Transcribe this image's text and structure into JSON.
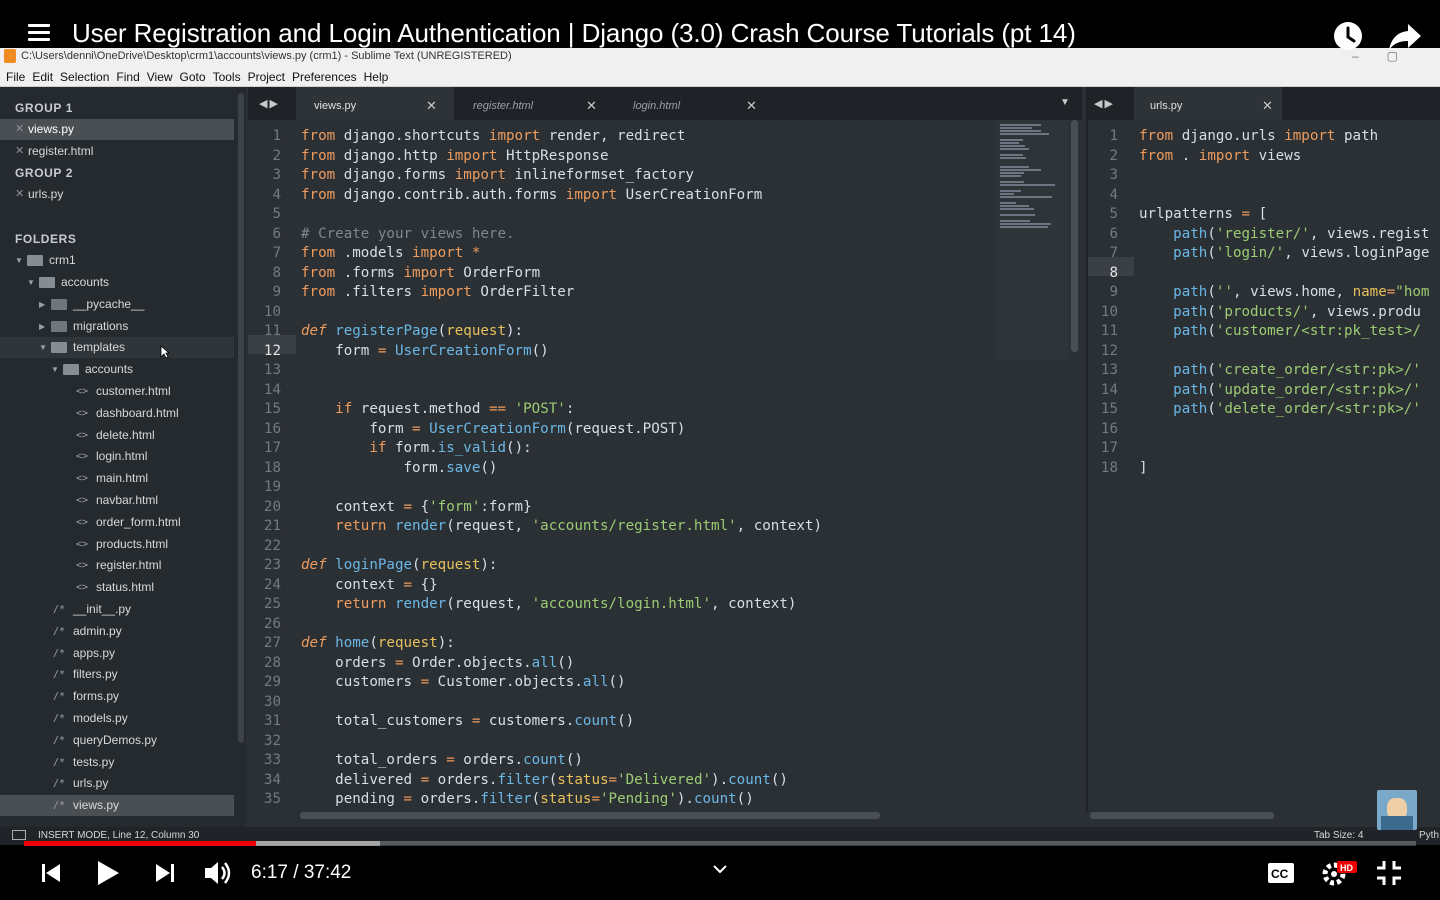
{
  "video": {
    "title": "User Registration and Login Authentication | Django (3.0) Crash Course Tutorials (pt 14)",
    "time_display": "6:17 / 37:42",
    "progress_fraction": 0.167,
    "buffered_fraction": 0.256
  },
  "window": {
    "title": "C:\\Users\\denni\\OneDrive\\Desktop\\crm1\\accounts\\views.py (crm1) - Sublime Text (UNREGISTERED)",
    "menu": [
      "File",
      "Edit",
      "Selection",
      "Find",
      "View",
      "Goto",
      "Tools",
      "Project",
      "Preferences",
      "Help"
    ]
  },
  "sidebar": {
    "group1": "GROUP 1",
    "group1_files": [
      "views.py",
      "register.html"
    ],
    "group2": "GROUP 2",
    "group2_files": [
      "urls.py"
    ],
    "folders_label": "FOLDERS",
    "tree": {
      "root": "crm1",
      "accounts": "accounts",
      "pycache": "__pycache__",
      "migrations": "migrations",
      "templates": "templates",
      "templates_accounts": "accounts",
      "templates_files": [
        "customer.html",
        "dashboard.html",
        "delete.html",
        "login.html",
        "main.html",
        "navbar.html",
        "order_form.html",
        "products.html",
        "register.html",
        "status.html"
      ],
      "py_files": [
        "__init__.py",
        "admin.py",
        "apps.py",
        "filters.py",
        "forms.py",
        "models.py",
        "queryDemos.py",
        "tests.py",
        "urls.py",
        "views.py"
      ]
    }
  },
  "tabs_left": [
    "views.py",
    "register.html",
    "login.html"
  ],
  "tabs_right": [
    "urls.py"
  ],
  "status": {
    "left": "INSERT MODE, Line 12, Column 30",
    "tab_size": "Tab Size: 4",
    "syntax": "Pyth"
  },
  "code_left": [
    [
      [
        "k",
        "from"
      ],
      [
        "t",
        " django.shortcuts "
      ],
      [
        "k",
        "import"
      ],
      [
        "t",
        " render, redirect"
      ]
    ],
    [
      [
        "k",
        "from"
      ],
      [
        "t",
        " django.http "
      ],
      [
        "k",
        "import"
      ],
      [
        "t",
        " HttpResponse"
      ]
    ],
    [
      [
        "k",
        "from"
      ],
      [
        "t",
        " django.forms "
      ],
      [
        "k",
        "import"
      ],
      [
        "t",
        " inlineformset_factory"
      ]
    ],
    [
      [
        "k",
        "from"
      ],
      [
        "t",
        " django.contrib.auth.forms "
      ],
      [
        "k",
        "import"
      ],
      [
        "t",
        " UserCreationForm"
      ]
    ],
    [],
    [
      [
        "c",
        "# Create your views here."
      ]
    ],
    [
      [
        "k",
        "from"
      ],
      [
        "t",
        " .models "
      ],
      [
        "k",
        "import"
      ],
      [
        "t",
        " "
      ],
      [
        "k",
        "*"
      ]
    ],
    [
      [
        "k",
        "from"
      ],
      [
        "t",
        " .forms "
      ],
      [
        "k",
        "import"
      ],
      [
        "t",
        " OrderForm"
      ]
    ],
    [
      [
        "k",
        "from"
      ],
      [
        "t",
        " .filters "
      ],
      [
        "k",
        "import"
      ],
      [
        "t",
        " OrderFilter"
      ]
    ],
    [],
    [
      [
        "it",
        "def"
      ],
      [
        "t",
        " "
      ],
      [
        "nm",
        "registerPage"
      ],
      [
        "t",
        "("
      ],
      [
        "f2",
        "request"
      ],
      [
        "t",
        "):"
      ]
    ],
    [
      [
        "t",
        "    form "
      ],
      [
        "k",
        "="
      ],
      [
        "t",
        " "
      ],
      [
        "fn",
        "UserCreationForm"
      ],
      [
        "t",
        "()"
      ]
    ],
    [],
    [],
    [
      [
        "t",
        "    "
      ],
      [
        "k",
        "if"
      ],
      [
        "t",
        " request.method "
      ],
      [
        "k",
        "=="
      ],
      [
        "t",
        " "
      ],
      [
        "s",
        "'POST'"
      ],
      [
        "t",
        ":"
      ]
    ],
    [
      [
        "t",
        "        form "
      ],
      [
        "k",
        "="
      ],
      [
        "t",
        " "
      ],
      [
        "fn",
        "UserCreationForm"
      ],
      [
        "t",
        "(request.POST)"
      ]
    ],
    [
      [
        "t",
        "        "
      ],
      [
        "k",
        "if"
      ],
      [
        "t",
        " form."
      ],
      [
        "fn",
        "is_valid"
      ],
      [
        "t",
        "():"
      ]
    ],
    [
      [
        "t",
        "            form."
      ],
      [
        "fn",
        "save"
      ],
      [
        "t",
        "()"
      ]
    ],
    [],
    [
      [
        "t",
        "    context "
      ],
      [
        "k",
        "="
      ],
      [
        "t",
        " {"
      ],
      [
        "s",
        "'form'"
      ],
      [
        "t",
        ":form}"
      ]
    ],
    [
      [
        "t",
        "    "
      ],
      [
        "k",
        "return"
      ],
      [
        "t",
        " "
      ],
      [
        "fn",
        "render"
      ],
      [
        "t",
        "(request, "
      ],
      [
        "s",
        "'accounts/register.html'"
      ],
      [
        "t",
        ", context)"
      ]
    ],
    [],
    [
      [
        "it",
        "def"
      ],
      [
        "t",
        " "
      ],
      [
        "nm",
        "loginPage"
      ],
      [
        "t",
        "("
      ],
      [
        "f2",
        "request"
      ],
      [
        "t",
        "):"
      ]
    ],
    [
      [
        "t",
        "    context "
      ],
      [
        "k",
        "="
      ],
      [
        "t",
        " {}"
      ]
    ],
    [
      [
        "t",
        "    "
      ],
      [
        "k",
        "return"
      ],
      [
        "t",
        " "
      ],
      [
        "fn",
        "render"
      ],
      [
        "t",
        "(request, "
      ],
      [
        "s",
        "'accounts/login.html'"
      ],
      [
        "t",
        ", context)"
      ]
    ],
    [],
    [
      [
        "it",
        "def"
      ],
      [
        "t",
        " "
      ],
      [
        "nm",
        "home"
      ],
      [
        "t",
        "("
      ],
      [
        "f2",
        "request"
      ],
      [
        "t",
        "):"
      ]
    ],
    [
      [
        "t",
        "    orders "
      ],
      [
        "k",
        "="
      ],
      [
        "t",
        " Order.objects."
      ],
      [
        "fn",
        "all"
      ],
      [
        "t",
        "()"
      ]
    ],
    [
      [
        "t",
        "    customers "
      ],
      [
        "k",
        "="
      ],
      [
        "t",
        " Customer.objects."
      ],
      [
        "fn",
        "all"
      ],
      [
        "t",
        "()"
      ]
    ],
    [],
    [
      [
        "t",
        "    total_customers "
      ],
      [
        "k",
        "="
      ],
      [
        "t",
        " customers."
      ],
      [
        "fn",
        "count"
      ],
      [
        "t",
        "()"
      ]
    ],
    [],
    [
      [
        "t",
        "    total_orders "
      ],
      [
        "k",
        "="
      ],
      [
        "t",
        " orders."
      ],
      [
        "fn",
        "count"
      ],
      [
        "t",
        "()"
      ]
    ],
    [
      [
        "t",
        "    delivered "
      ],
      [
        "k",
        "="
      ],
      [
        "t",
        " orders."
      ],
      [
        "fn",
        "filter"
      ],
      [
        "t",
        "("
      ],
      [
        "f2",
        "status"
      ],
      [
        "k",
        "="
      ],
      [
        "s",
        "'Delivered'"
      ],
      [
        "t",
        ")."
      ],
      [
        "fn",
        "count"
      ],
      [
        "t",
        "()"
      ]
    ],
    [
      [
        "t",
        "    pending "
      ],
      [
        "k",
        "="
      ],
      [
        "t",
        " orders."
      ],
      [
        "fn",
        "filter"
      ],
      [
        "t",
        "("
      ],
      [
        "f2",
        "status"
      ],
      [
        "k",
        "="
      ],
      [
        "s",
        "'Pending'"
      ],
      [
        "t",
        ")."
      ],
      [
        "fn",
        "count"
      ],
      [
        "t",
        "()"
      ]
    ]
  ],
  "code_right": [
    [
      [
        "k",
        "from"
      ],
      [
        "t",
        " django.urls "
      ],
      [
        "k",
        "import"
      ],
      [
        "t",
        " path"
      ]
    ],
    [
      [
        "k",
        "from"
      ],
      [
        "t",
        " . "
      ],
      [
        "k",
        "import"
      ],
      [
        "t",
        " views"
      ]
    ],
    [],
    [],
    [
      [
        "t",
        "urlpatterns "
      ],
      [
        "k",
        "="
      ],
      [
        "t",
        " ["
      ]
    ],
    [
      [
        "t",
        "    "
      ],
      [
        "fn",
        "path"
      ],
      [
        "t",
        "("
      ],
      [
        "s",
        "'register/'"
      ],
      [
        "t",
        ", views.regist"
      ]
    ],
    [
      [
        "t",
        "    "
      ],
      [
        "fn",
        "path"
      ],
      [
        "t",
        "("
      ],
      [
        "s",
        "'login/'"
      ],
      [
        "t",
        ", views.loginPage"
      ]
    ],
    [],
    [
      [
        "t",
        "    "
      ],
      [
        "fn",
        "path"
      ],
      [
        "t",
        "("
      ],
      [
        "s",
        "''"
      ],
      [
        "t",
        ", views.home, "
      ],
      [
        "f2",
        "name"
      ],
      [
        "k",
        "="
      ],
      [
        "s",
        "\"hom"
      ]
    ],
    [
      [
        "t",
        "    "
      ],
      [
        "fn",
        "path"
      ],
      [
        "t",
        "("
      ],
      [
        "s",
        "'products/'"
      ],
      [
        "t",
        ", views.produ"
      ]
    ],
    [
      [
        "t",
        "    "
      ],
      [
        "fn",
        "path"
      ],
      [
        "t",
        "("
      ],
      [
        "s",
        "'customer/<str:pk_test>/"
      ]
    ],
    [],
    [
      [
        "t",
        "    "
      ],
      [
        "fn",
        "path"
      ],
      [
        "t",
        "("
      ],
      [
        "s",
        "'create_order/<str:pk>/'"
      ]
    ],
    [
      [
        "t",
        "    "
      ],
      [
        "fn",
        "path"
      ],
      [
        "t",
        "("
      ],
      [
        "s",
        "'update_order/<str:pk>/'"
      ]
    ],
    [
      [
        "t",
        "    "
      ],
      [
        "fn",
        "path"
      ],
      [
        "t",
        "("
      ],
      [
        "s",
        "'delete_order/<str:pk>/'"
      ]
    ],
    [],
    [],
    [
      [
        "t",
        "]"
      ]
    ]
  ]
}
